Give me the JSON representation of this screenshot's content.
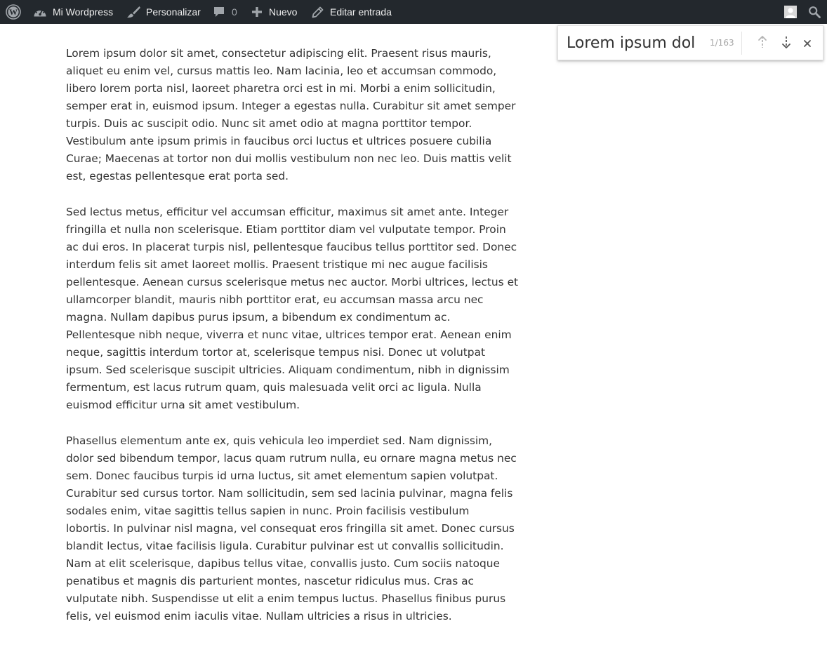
{
  "admin_bar": {
    "site_name": "Mi Wordpress",
    "customize": "Personalizar",
    "comments_count": "0",
    "new": "Nuevo",
    "edit": "Editar entrada"
  },
  "find_bar": {
    "query": "Lorem ipsum dol",
    "count": "1/163"
  },
  "highlight_colors": {
    "blue": "#8cc0ea",
    "green": "#9dd15c",
    "purple": "#d0b7e2",
    "pink": "#f6a4e8",
    "yellow": "#ffd61c",
    "orange": "#f7b97c",
    "teal": "#52d3b3",
    "current_outline": "#e8675f"
  },
  "content": {
    "paragraphs": [
      "Lorem ipsum dolor sit amet, consectetur adipiscing elit. Praesent risus mauris,\naliquet eu enim vel, cursus mattis leo. Nam lacinia, leo et accumsan commodo,\nlibero lorem porta nisl, laoreet pharetra orci est in mi. Morbi a enim sollicitudin,\nsemper erat in, euismod ipsum. Integer a egestas nulla. Curabitur sit amet semper\nturpis. Duis ac suscipit odio. Nunc sit amet odio at magna porttitor tempor.\nVestibulum ante ipsum primis in faucibus orci luctus et ultrices posuere cubilia\nCurae; Maecenas at tortor non dui mollis vestibulum non nec leo. Duis mattis velit\nest, egestas pellentesque erat porta sed.",
      "Sed lectus metus, efficitur vel accumsan efficitur, maximus sit amet ante. Integer\nfringilla et nulla non scelerisque. Etiam porttitor diam vel vulputate tempor. Proin\nac dui eros. In placerat turpis nisl, pellentesque faucibus tellus porttitor sed. Donec\ninterdum felis sit amet laoreet mollis. Praesent tristique mi nec augue facilisis\npellentesque. Aenean cursus scelerisque metus nec auctor. Morbi ultrices, lectus et\nullamcorper blandit, mauris nibh porttitor erat, eu accumsan massa arcu nec\nmagna. Nullam dapibus purus ipsum, a bibendum ex condimentum ac.\nPellentesque nibh neque, viverra et nunc vitae, ultrices tempor erat. Aenean enim\nneque, sagittis interdum tortor at, scelerisque tempus nisi. Donec ut volutpat\nipsum. Sed scelerisque suscipit ultricies. Aliquam condimentum, nibh in dignissim\nfermentum, est lacus rutrum quam, quis malesuada velit orci ac ligula. Nulla\neuismod efficitur urna sit amet vestibulum.",
      "Phasellus elementum ante ex, quis vehicula leo imperdiet sed. Nam dignissim,\ndolor sed bibendum tempor, lacus quam rutrum nulla, eu ornare magna metus nec\nsem. Donec faucibus turpis id urna luctus, sit amet elementum sapien volutpat.\nCurabitur sed cursus tortor. Nam sollicitudin, sem sed lacinia pulvinar, magna felis\nsodales enim, vitae sagittis tellus sapien in nunc. Proin facilisis vestibulum\nlobortis. In pulvinar nisl magna, vel consequat eros fringilla sit amet. Donec cursus\nblandit lectus, vitae facilisis ligula. Curabitur pulvinar est ut convallis sollicitudin.\nNam at elit scelerisque, dapibus tellus vitae, convallis justo. Cum sociis natoque\npenatibus et magnis dis parturient montes, nascetur ridiculus mus. Cras ac\nvulputate nibh. Suspendisse ut elit a enim tempus luctus. Phasellus finibus purus\nfelis, vel euismod enim iaculis vitae. Nullam ultricies a risus in ultricies."
    ]
  }
}
